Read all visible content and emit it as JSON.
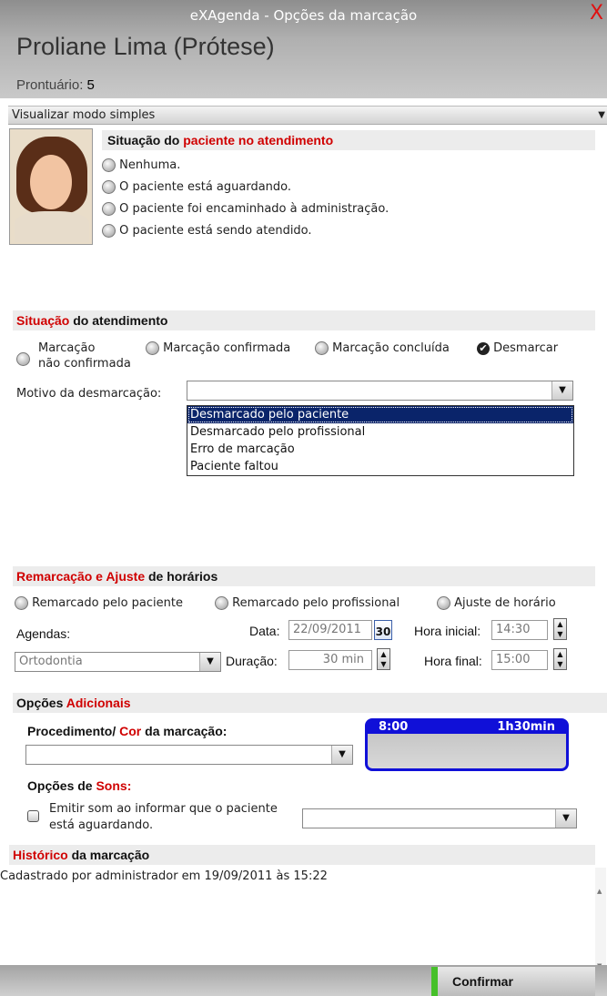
{
  "window": {
    "title": "eXAgenda - Opções da marcação",
    "close_glyph": "X"
  },
  "patient": {
    "name": "Proliane Lima (Prótese)",
    "record_label": "Prontuário:",
    "record_number": "5"
  },
  "mode_bar": {
    "label": "Visualizar modo simples",
    "arrow": "▼"
  },
  "patient_status": {
    "title_prefix": "Situação do ",
    "title_red": "paciente no atendimento",
    "options": [
      "Nenhuma.",
      "O paciente está aguardando.",
      "O paciente foi encaminhado à administração.",
      "O paciente está sendo atendido."
    ]
  },
  "appointment_status": {
    "title_red": "Situação",
    "title_rest": " do atendimento",
    "options": {
      "unconfirmed_line1": "Marcação",
      "unconfirmed_line2": "não confirmada",
      "confirmed": "Marcação confirmada",
      "concluded": "Marcação concluída",
      "cancel": "Desmarcar"
    },
    "cancel_checked": true,
    "reason_label": "Motivo da desmarcação:",
    "reason_value": "",
    "reason_options": [
      "Desmarcado pelo paciente",
      "Desmarcado pelo profissional",
      "Erro de marcação",
      "Paciente faltou"
    ],
    "reason_highlighted": "Desmarcado pelo paciente"
  },
  "reschedule": {
    "title_red": "Remarcação e Ajuste",
    "title_rest": " de horários",
    "options": [
      "Remarcado pelo paciente",
      "Remarcado pelo profissional",
      "Ajuste de horário"
    ],
    "agendas_label": "Agendas:",
    "agenda_value": "Ortodontia",
    "date_label": "Data:",
    "date_value": "22/09/2011",
    "calendar_day": "30",
    "start_label": "Hora inicial:",
    "start_value": "14:30",
    "duration_label": "Duração:",
    "duration_value": "30 min",
    "end_label": "Hora final:",
    "end_value": "15:00"
  },
  "additional": {
    "title_prefix": "Opções ",
    "title_red": "Adicionais",
    "procedure_label_a": "Procedimento/ ",
    "procedure_label_red": "Cor",
    "procedure_label_b": " da marcação:",
    "procedure_value": "",
    "preview_time": "8:00",
    "preview_duration": "1h30min",
    "preview_color": "#1010d8",
    "sounds_label_a": "Opções de ",
    "sounds_label_red": "Sons:",
    "sound_check_line1": "Emitir som ao informar que o paciente",
    "sound_check_line2": "está aguardando.",
    "sound_value": ""
  },
  "history": {
    "title_red": "Histórico",
    "title_rest": " da marcação",
    "entry": "Cadastrado por administrador em 19/09/2011 às 15:22"
  },
  "footer": {
    "confirm_label": "Confirmar",
    "accent": "#46c02a"
  }
}
